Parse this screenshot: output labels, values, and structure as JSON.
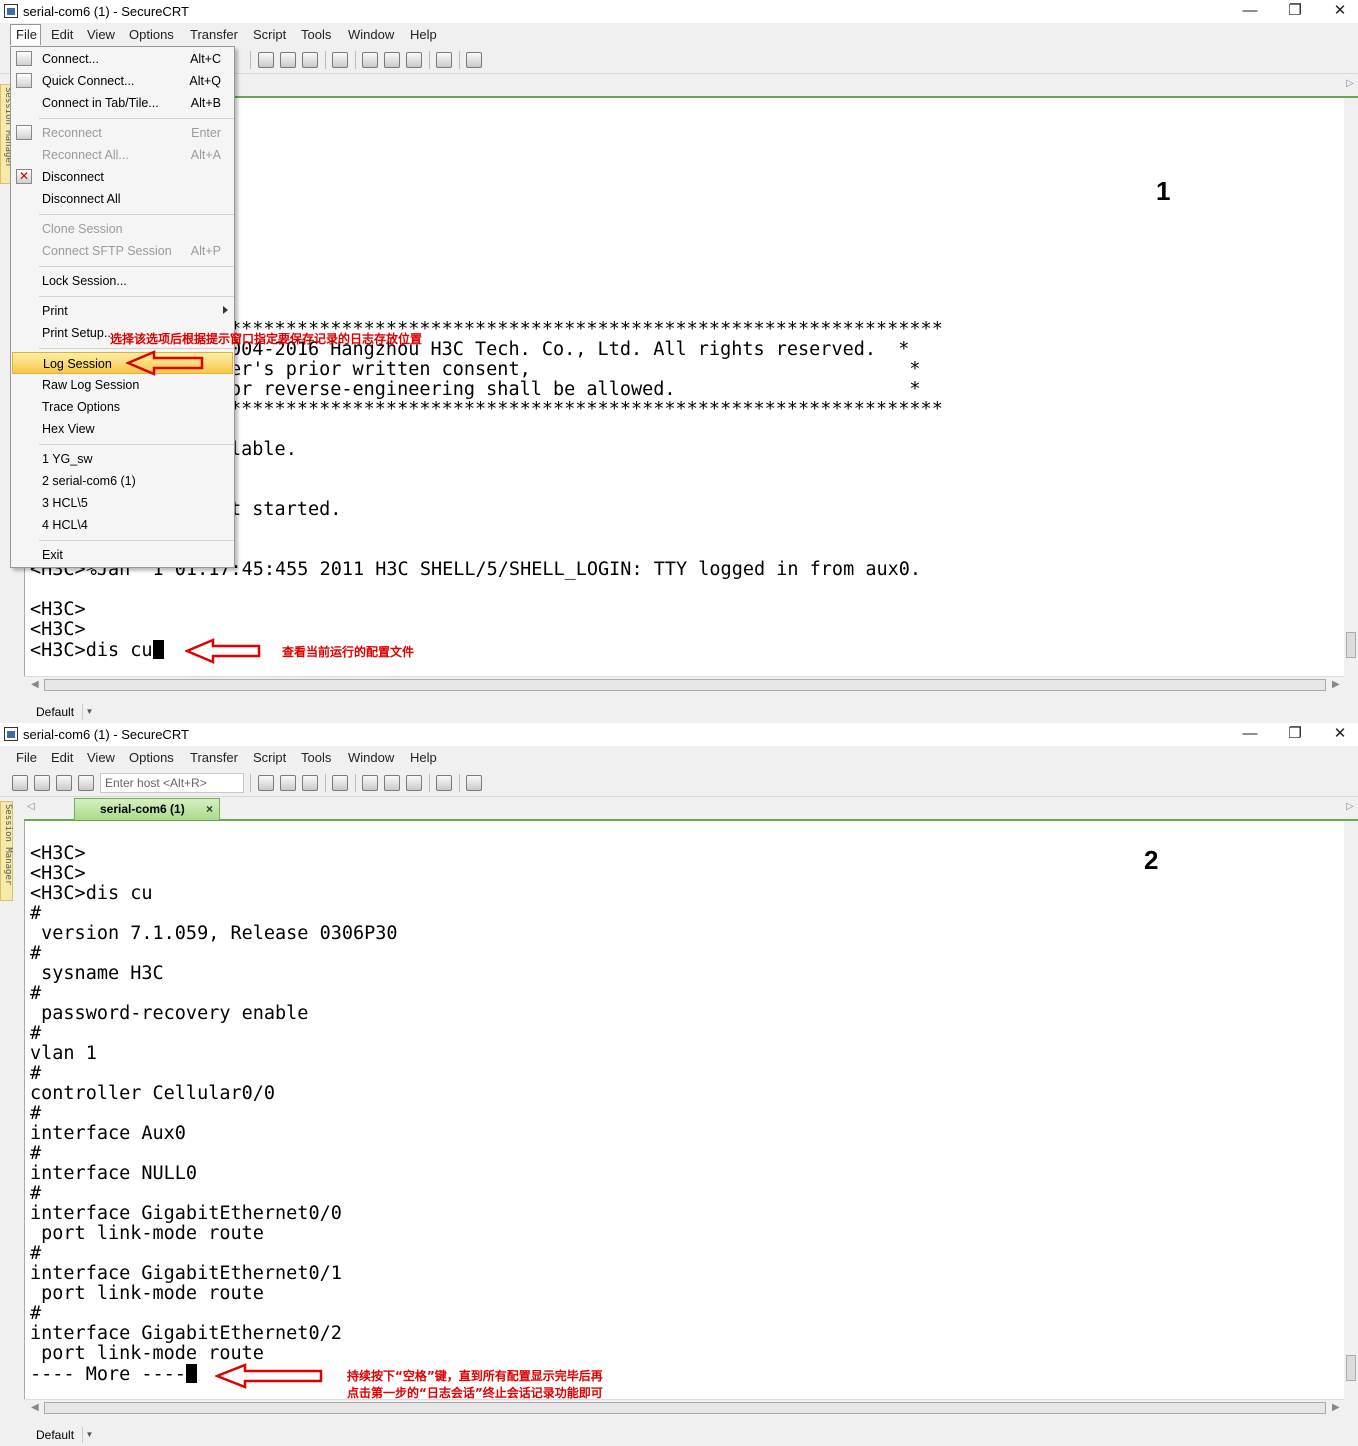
{
  "app_title": "serial-com6 (1) - SecureCRT",
  "window_controls": {
    "minimize": "—",
    "restore": "❐",
    "close": "✕"
  },
  "menubar": [
    "File",
    "Edit",
    "View",
    "Options",
    "Transfer",
    "Script",
    "Tools",
    "Window",
    "Help"
  ],
  "toolbar": {
    "host_placeholder": "Enter host <Alt+R>"
  },
  "tab": {
    "label": "serial-com6 (1)",
    "close": "×"
  },
  "side_panel": "Session Manager",
  "status": {
    "label": "Default",
    "dropdown": "▼"
  },
  "file_menu": {
    "items": [
      {
        "label": "Connect...",
        "shortcut": "Alt+C"
      },
      {
        "label": "Quick Connect...",
        "shortcut": "Alt+Q"
      },
      {
        "label": "Connect in Tab/Tile...",
        "shortcut": "Alt+B"
      },
      {
        "label": "Reconnect",
        "shortcut": "Enter"
      },
      {
        "label": "Reconnect All...",
        "shortcut": "Alt+A"
      },
      {
        "label": "Disconnect",
        "shortcut": ""
      },
      {
        "label": "Disconnect All",
        "shortcut": ""
      },
      {
        "label": "Clone Session",
        "shortcut": ""
      },
      {
        "label": "Connect SFTP Session",
        "shortcut": "Alt+P"
      },
      {
        "label": "Lock Session...",
        "shortcut": ""
      },
      {
        "label": "Print",
        "shortcut": ""
      },
      {
        "label": "Print Setup...",
        "shortcut": ""
      },
      {
        "label": "Log Session",
        "shortcut": ""
      },
      {
        "label": "Raw Log Session",
        "shortcut": ""
      },
      {
        "label": "Trace Options",
        "shortcut": ""
      },
      {
        "label": "Hex View",
        "shortcut": ""
      },
      {
        "label": "1 YG_sw",
        "shortcut": ""
      },
      {
        "label": "2 serial-com6 (1)",
        "shortcut": ""
      },
      {
        "label": "3 HCL\\5",
        "shortcut": ""
      },
      {
        "label": "4 HCL\\4",
        "shortcut": ""
      },
      {
        "label": "Exit",
        "shortcut": ""
      }
    ]
  },
  "terminal1": {
    "lines": [
      "****************************************************************",
      "004-2016 Hangzhou H3C Tech. Co., Ltd. All rights reserved.  *",
      "er's prior written consent,                                  *",
      "or reverse-engineering shall be allowed.                     *",
      "****************************************************************",
      "lable.",
      "t started.",
      "<H3C>%Jan  1 01:17:45:455 2011 H3C SHELL/5/SHELL_LOGIN: TTY logged in from aux0.",
      "<H3C>",
      "<H3C>",
      "<H3C>dis cu"
    ]
  },
  "terminal2": {
    "lines": [
      "<H3C>",
      "<H3C>",
      "<H3C>dis cu",
      "#",
      " version 7.1.059, Release 0306P30",
      "#",
      " sysname H3C",
      "#",
      " password-recovery enable",
      "#",
      "vlan 1",
      "#",
      "controller Cellular0/0",
      "#",
      "interface Aux0",
      "#",
      "interface NULL0",
      "#",
      "interface GigabitEthernet0/0",
      " port link-mode route",
      "#",
      "interface GigabitEthernet0/1",
      " port link-mode route",
      "#",
      "interface GigabitEthernet0/2",
      " port link-mode route",
      "---- More ----"
    ]
  },
  "annotations": {
    "step1": "1",
    "step2": "2",
    "log_note": "选择该选项后根据提示窗口指定要保存记录的日志存放位置",
    "dis_note": "查看当前运行的配置文件",
    "more_note_1": "持续按下“空格”键，直到所有配置显示完毕后再",
    "more_note_2": "点击第一步的“日志会话”终止会话记录功能即可"
  },
  "colors": {
    "annotation": "#e00000",
    "tab_active": "#a8d98a",
    "menu_highlight": "#f6c84a"
  }
}
